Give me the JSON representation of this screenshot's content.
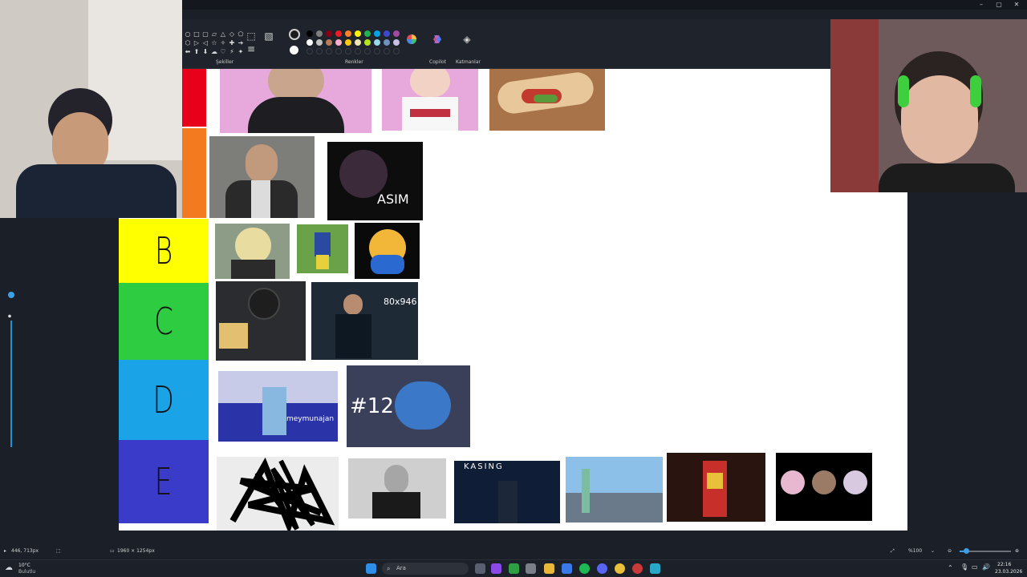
{
  "window": {
    "minimize": "–",
    "maximize": "▢",
    "close": "✕"
  },
  "ribbon": {
    "shapes_label": "Şekiller",
    "colors_label": "Renkler",
    "copilot_label": "Copilot",
    "layers_label": "Katmanlar",
    "shape_glyphs": [
      "○",
      "□",
      "▢",
      "▱",
      "△",
      "◇",
      "⬠",
      "⬡",
      "▷",
      "◁",
      "☆",
      "✧",
      "✚",
      "➔",
      "⬅",
      "⬆",
      "⬇",
      "☁",
      "♡",
      "⚡",
      "✦"
    ],
    "color_swatches": [
      "#000000",
      "#7f7f7f",
      "#880015",
      "#ed1c24",
      "#ff7f27",
      "#fff200",
      "#22b14c",
      "#00a2e8",
      "#3f48cc",
      "#a349a4",
      "#ffffff",
      "#c3c3c3",
      "#b97a57",
      "#ffaec9",
      "#ffc90e",
      "#efe4b0",
      "#b5e61d",
      "#99d9ea",
      "#7092be",
      "#c8bfe7",
      "#3a3f48",
      "#3a3f48",
      "#3a3f48",
      "#3a3f48",
      "#3a3f48",
      "#3a3f48",
      "#3a3f48",
      "#3a3f48",
      "#3a3f48",
      "#3a3f48"
    ]
  },
  "tierlist": {
    "tiers": [
      {
        "label": "B",
        "color": "#ffff00"
      },
      {
        "label": "C",
        "color": "#2ecc40"
      },
      {
        "label": "D",
        "color": "#1aa3e6"
      },
      {
        "label": "E",
        "color": "#3b3bc9"
      }
    ],
    "top_colors": [
      "#e8001a",
      "#f47a20"
    ],
    "captions": {
      "asim": "ASIM",
      "dims": "80x946",
      "meymun": "meymunajan",
      "hash12": "#12",
      "kasing": "KASING"
    }
  },
  "statusbar": {
    "cursor_pos": "446, 713px",
    "canvas_size": "1960 × 1254px",
    "zoom": "%100"
  },
  "taskbar": {
    "weather_temp": "10°C",
    "weather_desc": "Bulutlu",
    "search_placeholder": "Ara",
    "time": "22:16",
    "date": "23.03.2026"
  }
}
